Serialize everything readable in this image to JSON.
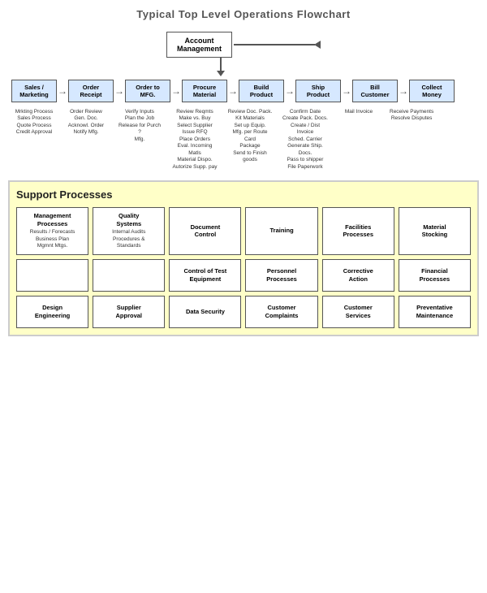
{
  "title": "Typical Top Level Operations Flowchart",
  "acct_mgmt": {
    "line1": "Account",
    "line2": "Management"
  },
  "processes": [
    {
      "label": "Sales /\nMarketing",
      "details": "Mrkting Process\nSales Process\nQuote Process\nCredit Approval"
    },
    {
      "label": "Order\nReceipt",
      "details": "Order Review\nGen. Doc.\nAcknowl. Order\nNotify Mfg."
    },
    {
      "label": "Order to\nMFG.",
      "details": "Verify Inputs\nPlan the Job\nRelease for Purch ?\nMfg."
    },
    {
      "label": "Procure\nMaterial",
      "details": "Review Reqmts\nMake vs. Buy\nSelect Supplier\nIssue RFQ\nPlace Orders\nEval. Incoming Matls\nMaterial Dispo.\nAutorize Supp. pay"
    },
    {
      "label": "Build\nProduct",
      "details": "Review Doc. Pack.\nKit Materials\nSet up Equip.\nMfg. per Route Card\nPackage\nSend to Finish goods"
    },
    {
      "label": "Ship\nProduct",
      "details": "Confirm Date\nCreate Pack. Docs.\nCreate / Dist Invoice\nSched. Carrier\nGenerate Ship. Docs.\nPass to shipper\nFile Paperwork"
    },
    {
      "label": "Bill\nCustomer",
      "details": "Mail Invoice"
    },
    {
      "label": "Collect\nMoney",
      "details": "Receive Payments\nResolve Disputes"
    }
  ],
  "support": {
    "title": "Support Processes",
    "items": [
      {
        "label": "Management\nProcesses",
        "sub": "Results / Forecasts\nBusiness Plan\nMgmnt Mtgs."
      },
      {
        "label": "Quality\nSystems",
        "sub": "Internal Audits\nProcedures &\nStandards"
      },
      {
        "label": "Document\nControl",
        "sub": ""
      },
      {
        "label": "Training",
        "sub": ""
      },
      {
        "label": "Facilities\nProcesses",
        "sub": ""
      },
      {
        "label": "Material\nStocking",
        "sub": ""
      },
      {
        "label": "",
        "sub": ""
      },
      {
        "label": "",
        "sub": ""
      },
      {
        "label": "Control of Test\nEquipment",
        "sub": ""
      },
      {
        "label": "Personnel\nProcesses",
        "sub": ""
      },
      {
        "label": "Corrective\nAction",
        "sub": ""
      },
      {
        "label": "Financial\nProcesses",
        "sub": ""
      },
      {
        "label": "Design\nEngineering",
        "sub": ""
      },
      {
        "label": "Supplier\nApproval",
        "sub": ""
      },
      {
        "label": "Data Security",
        "sub": ""
      },
      {
        "label": "Customer\nComplaints",
        "sub": ""
      },
      {
        "label": "Customer\nServices",
        "sub": ""
      },
      {
        "label": "Preventative\nMaintenance",
        "sub": ""
      }
    ]
  }
}
